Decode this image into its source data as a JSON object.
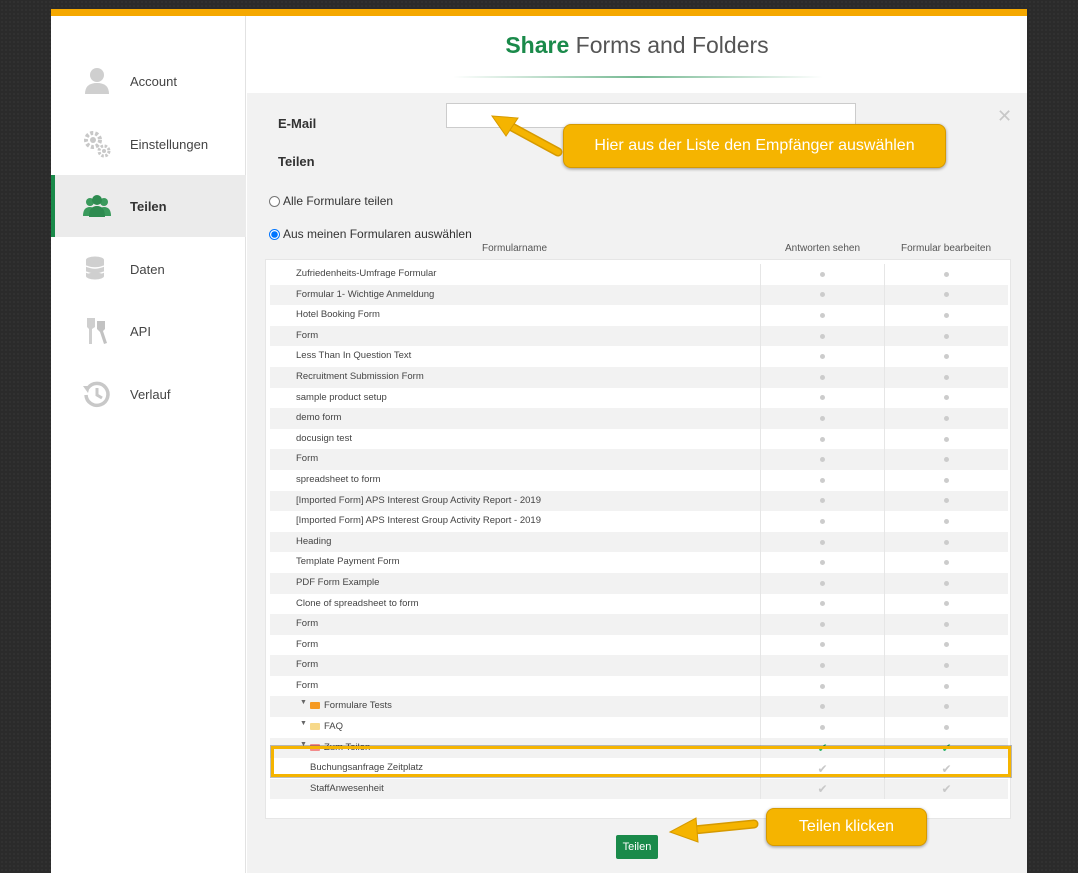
{
  "colors": {
    "accent": "#1a8a4a",
    "highlight": "#f5b400"
  },
  "sidebar": {
    "items": [
      {
        "label": "Account",
        "icon": "user-icon",
        "active": false
      },
      {
        "label": "Einstellungen",
        "icon": "gears-icon",
        "active": false
      },
      {
        "label": "Teilen",
        "icon": "users-icon",
        "active": true
      },
      {
        "label": "Daten",
        "icon": "database-icon",
        "active": false
      },
      {
        "label": "API",
        "icon": "keys-icon",
        "active": false
      },
      {
        "label": "Verlauf",
        "icon": "history-icon",
        "active": false
      }
    ]
  },
  "header": {
    "title_accent": "Share",
    "title_rest": " Forms and Folders"
  },
  "form": {
    "email_label": "E-Mail",
    "email_value": "",
    "share_label": "Teilen",
    "radio_all": "Alle Formulare teilen",
    "radio_select": "Aus meinen Formularen auswählen",
    "radio_selected": "select"
  },
  "table": {
    "headers": [
      "Formularname",
      "Antworten sehen",
      "Formular bearbeiten"
    ],
    "rows": [
      {
        "name": "Zufriedenheits-Umfrage Formular",
        "type": "form",
        "c1": "dot",
        "c2": "dot"
      },
      {
        "name": "Formular 1- Wichtige Anmeldung",
        "type": "form",
        "c1": "dot",
        "c2": "dot"
      },
      {
        "name": "Hotel Booking Form",
        "type": "form",
        "c1": "dot",
        "c2": "dot"
      },
      {
        "name": "Form",
        "type": "form",
        "c1": "dot",
        "c2": "dot"
      },
      {
        "name": "Less Than In Question Text",
        "type": "form",
        "c1": "dot",
        "c2": "dot"
      },
      {
        "name": "Recruitment Submission Form",
        "type": "form",
        "c1": "dot",
        "c2": "dot"
      },
      {
        "name": "sample product setup",
        "type": "form",
        "c1": "dot",
        "c2": "dot"
      },
      {
        "name": "demo form",
        "type": "form",
        "c1": "dot",
        "c2": "dot"
      },
      {
        "name": "docusign test",
        "type": "form",
        "c1": "dot",
        "c2": "dot"
      },
      {
        "name": "Form",
        "type": "form",
        "c1": "dot",
        "c2": "dot"
      },
      {
        "name": "spreadsheet to form",
        "type": "form",
        "c1": "dot",
        "c2": "dot"
      },
      {
        "name": "[Imported Form] APS Interest Group Activity Report - 2019",
        "type": "form",
        "c1": "dot",
        "c2": "dot"
      },
      {
        "name": "[Imported Form] APS Interest Group Activity Report - 2019",
        "type": "form",
        "c1": "dot",
        "c2": "dot"
      },
      {
        "name": "Heading",
        "type": "form",
        "c1": "dot",
        "c2": "dot"
      },
      {
        "name": "Template Payment Form",
        "type": "form",
        "c1": "dot",
        "c2": "dot"
      },
      {
        "name": "PDF Form Example",
        "type": "form",
        "c1": "dot",
        "c2": "dot"
      },
      {
        "name": "Clone of spreadsheet to form",
        "type": "form",
        "c1": "dot",
        "c2": "dot"
      },
      {
        "name": "Form",
        "type": "form",
        "c1": "dot",
        "c2": "dot"
      },
      {
        "name": "Form",
        "type": "form",
        "c1": "dot",
        "c2": "dot"
      },
      {
        "name": "Form",
        "type": "form",
        "c1": "dot",
        "c2": "dot"
      },
      {
        "name": "Form",
        "type": "form",
        "c1": "dot",
        "c2": "dot"
      },
      {
        "name": "Formulare Tests",
        "type": "folder",
        "folder_color": "#f59a23",
        "c1": "dot",
        "c2": "dot"
      },
      {
        "name": "FAQ",
        "type": "folder",
        "folder_color": "#f7d98a",
        "c1": "dot",
        "c2": "dot"
      },
      {
        "name": "Zum Teilen",
        "type": "folder",
        "folder_color": "#f28b8b",
        "c1": "check",
        "c2": "check"
      },
      {
        "name": "Buchungsanfrage Zeitplatz",
        "type": "child",
        "c1": "check-gray",
        "c2": "check-gray"
      },
      {
        "name": "StaffAnwesenheit",
        "type": "child",
        "c1": "check-gray",
        "c2": "check-gray"
      }
    ]
  },
  "share_button": "Teilen",
  "callouts": {
    "email_hint": "Hier aus der Liste den Empfänger auswählen",
    "share_hint": "Teilen klicken"
  }
}
